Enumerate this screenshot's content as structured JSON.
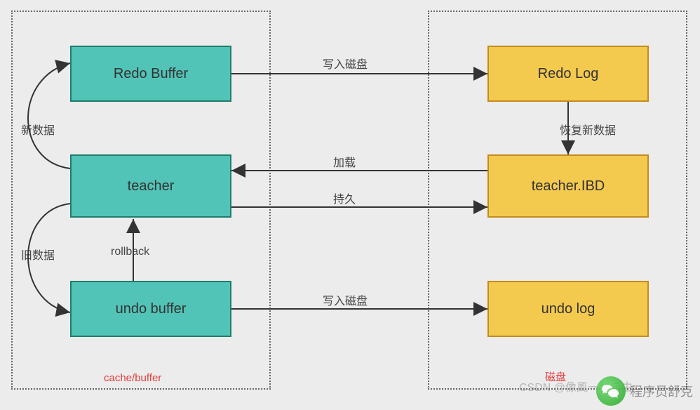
{
  "chart_data": {
    "type": "diagram",
    "containers": [
      {
        "id": "cache-buffer",
        "label": "cache/buffer",
        "side": "left"
      },
      {
        "id": "disk",
        "label": "磁盘",
        "side": "right"
      }
    ],
    "nodes": [
      {
        "id": "redo-buffer",
        "label": "Redo Buffer",
        "container": "cache-buffer",
        "color": "teal"
      },
      {
        "id": "teacher",
        "label": "teacher",
        "container": "cache-buffer",
        "color": "teal"
      },
      {
        "id": "undo-buffer",
        "label": "undo buffer",
        "container": "cache-buffer",
        "color": "teal"
      },
      {
        "id": "redo-log",
        "label": "Redo Log",
        "container": "disk",
        "color": "gold"
      },
      {
        "id": "teacher-ibd",
        "label": "teacher.IBD",
        "container": "disk",
        "color": "gold"
      },
      {
        "id": "undo-log",
        "label": "undo log",
        "container": "disk",
        "color": "gold"
      }
    ],
    "edges": [
      {
        "from": "redo-buffer",
        "to": "redo-log",
        "label": "写入磁盘"
      },
      {
        "from": "redo-log",
        "to": "teacher-ibd",
        "label": "恢复新数据"
      },
      {
        "from": "teacher-ibd",
        "to": "teacher",
        "label": "加载"
      },
      {
        "from": "teacher",
        "to": "teacher-ibd",
        "label": "持久"
      },
      {
        "from": "undo-buffer",
        "to": "undo-log",
        "label": "写入磁盘"
      },
      {
        "from": "undo-buffer",
        "to": "teacher",
        "label": "rollback"
      },
      {
        "from": "teacher",
        "to": "redo-buffer",
        "label": "新数据",
        "curved": true
      },
      {
        "from": "teacher",
        "to": "undo-buffer",
        "label": "旧数据",
        "curved": true
      }
    ]
  },
  "watermarks": {
    "csdn": "CSDN @像風一様自由",
    "wechat_name": "程序员舒克"
  }
}
